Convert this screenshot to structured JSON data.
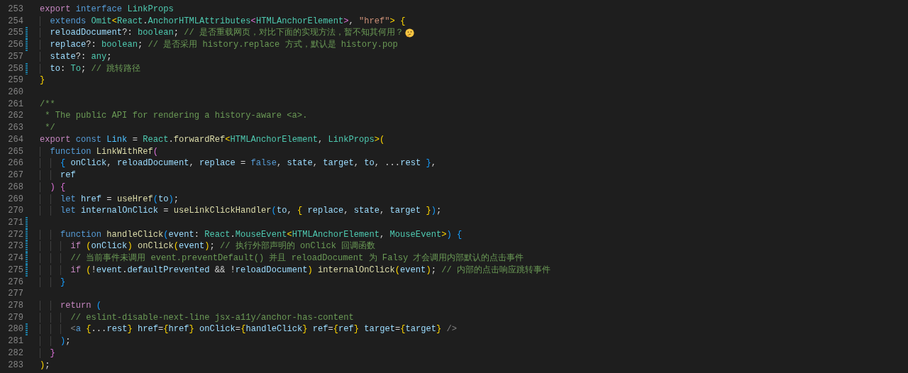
{
  "lines": [
    {
      "number": "253",
      "modified": false,
      "tokens": [
        {
          "kind": "control",
          "text": "export"
        },
        {
          "kind": "keyword",
          "text": " interface"
        },
        {
          "kind": "type",
          "text": " LinkProps"
        }
      ]
    },
    {
      "number": "254",
      "modified": false,
      "tokens": [
        {
          "kind": "keyword",
          "text": "  extends"
        },
        {
          "kind": "type",
          "text": " Omit"
        },
        {
          "kind": "bracket1",
          "text": "<"
        },
        {
          "kind": "type",
          "text": "React"
        },
        {
          "kind": "plain",
          "text": "."
        },
        {
          "kind": "type",
          "text": "AnchorHTMLAttributes"
        },
        {
          "kind": "bracket2",
          "text": "<"
        },
        {
          "kind": "type",
          "text": "HTMLAnchorElement"
        },
        {
          "kind": "bracket2",
          "text": ">"
        },
        {
          "kind": "plain",
          "text": ","
        },
        {
          "kind": "string",
          "text": " \"href\""
        },
        {
          "kind": "bracket1",
          "text": ">"
        },
        {
          "kind": "bracket1",
          "text": " {"
        }
      ]
    },
    {
      "number": "255",
      "modified": true,
      "tokens": [
        {
          "kind": "variable",
          "text": "  reloadDocument"
        },
        {
          "kind": "plain",
          "text": "?:"
        },
        {
          "kind": "type",
          "text": " boolean"
        },
        {
          "kind": "plain",
          "text": ";"
        },
        {
          "kind": "comment",
          "text": " // 是否重载网页，对比下面的实现方法，暂不知其何用？"
        },
        {
          "kind": "emoji"
        }
      ]
    },
    {
      "number": "256",
      "modified": true,
      "tokens": [
        {
          "kind": "variable",
          "text": "  replace"
        },
        {
          "kind": "plain",
          "text": "?:"
        },
        {
          "kind": "type",
          "text": " boolean"
        },
        {
          "kind": "plain",
          "text": ";"
        },
        {
          "kind": "comment",
          "text": " // 是否采用 history.replace 方式，默认是 history.pop"
        }
      ]
    },
    {
      "number": "257",
      "modified": false,
      "tokens": [
        {
          "kind": "variable",
          "text": "  state"
        },
        {
          "kind": "plain",
          "text": "?:"
        },
        {
          "kind": "type",
          "text": " any"
        },
        {
          "kind": "plain",
          "text": ";"
        }
      ]
    },
    {
      "number": "258",
      "modified": true,
      "tokens": [
        {
          "kind": "variable",
          "text": "  to"
        },
        {
          "kind": "plain",
          "text": ":"
        },
        {
          "kind": "type",
          "text": " To"
        },
        {
          "kind": "plain",
          "text": ";"
        },
        {
          "kind": "comment",
          "text": " // 跳转路径"
        }
      ]
    },
    {
      "number": "259",
      "modified": false,
      "tokens": [
        {
          "kind": "bracket1",
          "text": "}"
        }
      ]
    },
    {
      "number": "260",
      "modified": false
    },
    {
      "number": "261",
      "modified": false,
      "tokens": [
        {
          "kind": "comment",
          "text": "/**"
        }
      ]
    },
    {
      "number": "262",
      "modified": false,
      "tokens": [
        {
          "kind": "comment",
          "text": " * The public API for rendering a history-aware <a>."
        }
      ]
    },
    {
      "number": "263",
      "modified": false,
      "tokens": [
        {
          "kind": "comment",
          "text": " */"
        }
      ]
    },
    {
      "number": "264",
      "modified": false,
      "tokens": [
        {
          "kind": "control",
          "text": "export"
        },
        {
          "kind": "keyword",
          "text": " const"
        },
        {
          "kind": "constant",
          "text": " Link"
        },
        {
          "kind": "plain",
          "text": " ="
        },
        {
          "kind": "type",
          "text": " React"
        },
        {
          "kind": "plain",
          "text": "."
        },
        {
          "kind": "function",
          "text": "forwardRef"
        },
        {
          "kind": "bracket1",
          "text": "<"
        },
        {
          "kind": "type",
          "text": "HTMLAnchorElement"
        },
        {
          "kind": "plain",
          "text": ","
        },
        {
          "kind": "type",
          "text": " LinkProps"
        },
        {
          "kind": "bracket1",
          "text": ">"
        },
        {
          "kind": "bracket1",
          "text": "("
        }
      ]
    },
    {
      "number": "265",
      "modified": false,
      "tokens": [
        {
          "kind": "keyword",
          "text": "  function"
        },
        {
          "kind": "function",
          "text": " LinkWithRef"
        },
        {
          "kind": "bracket2",
          "text": "("
        }
      ]
    },
    {
      "number": "266",
      "modified": false,
      "tokens": [
        {
          "kind": "bracket3",
          "text": "    {"
        },
        {
          "kind": "variable",
          "text": " onClick"
        },
        {
          "kind": "plain",
          "text": ","
        },
        {
          "kind": "variable",
          "text": " reloadDocument"
        },
        {
          "kind": "plain",
          "text": ","
        },
        {
          "kind": "variable",
          "text": " replace"
        },
        {
          "kind": "plain",
          "text": " ="
        },
        {
          "kind": "keyword",
          "text": " false"
        },
        {
          "kind": "plain",
          "text": ","
        },
        {
          "kind": "variable",
          "text": " state"
        },
        {
          "kind": "plain",
          "text": ","
        },
        {
          "kind": "variable",
          "text": " target"
        },
        {
          "kind": "plain",
          "text": ","
        },
        {
          "kind": "variable",
          "text": " to"
        },
        {
          "kind": "plain",
          "text": ", ..."
        },
        {
          "kind": "variable",
          "text": "rest"
        },
        {
          "kind": "bracket3",
          "text": " }"
        },
        {
          "kind": "plain",
          "text": ","
        }
      ]
    },
    {
      "number": "267",
      "modified": false,
      "tokens": [
        {
          "kind": "variable",
          "text": "    ref"
        }
      ]
    },
    {
      "number": "268",
      "modified": false,
      "tokens": [
        {
          "kind": "bracket2",
          "text": "  )"
        },
        {
          "kind": "bracket2",
          "text": " {"
        }
      ]
    },
    {
      "number": "269",
      "modified": false,
      "tokens": [
        {
          "kind": "keyword",
          "text": "    let"
        },
        {
          "kind": "variable",
          "text": " href"
        },
        {
          "kind": "plain",
          "text": " ="
        },
        {
          "kind": "function",
          "text": " useHref"
        },
        {
          "kind": "bracket3",
          "text": "("
        },
        {
          "kind": "variable",
          "text": "to"
        },
        {
          "kind": "bracket3",
          "text": ")"
        },
        {
          "kind": "plain",
          "text": ";"
        }
      ]
    },
    {
      "number": "270",
      "modified": false,
      "tokens": [
        {
          "kind": "keyword",
          "text": "    let"
        },
        {
          "kind": "variable",
          "text": " internalOnClick"
        },
        {
          "kind": "plain",
          "text": " ="
        },
        {
          "kind": "function",
          "text": " useLinkClickHandler"
        },
        {
          "kind": "bracket3",
          "text": "("
        },
        {
          "kind": "variable",
          "text": "to"
        },
        {
          "kind": "plain",
          "text": ","
        },
        {
          "kind": "bracket1",
          "text": " {"
        },
        {
          "kind": "variable",
          "text": " replace"
        },
        {
          "kind": "plain",
          "text": ","
        },
        {
          "kind": "variable",
          "text": " state"
        },
        {
          "kind": "plain",
          "text": ","
        },
        {
          "kind": "variable",
          "text": " target"
        },
        {
          "kind": "bracket1",
          "text": " }"
        },
        {
          "kind": "bracket3",
          "text": ")"
        },
        {
          "kind": "plain",
          "text": ";"
        }
      ]
    },
    {
      "number": "271",
      "modified": true
    },
    {
      "number": "272",
      "modified": true,
      "tokens": [
        {
          "kind": "keyword",
          "text": "    function"
        },
        {
          "kind": "function",
          "text": " handleClick"
        },
        {
          "kind": "bracket3",
          "text": "("
        },
        {
          "kind": "variable",
          "text": "event"
        },
        {
          "kind": "plain",
          "text": ":"
        },
        {
          "kind": "type",
          "text": " React"
        },
        {
          "kind": "plain",
          "text": "."
        },
        {
          "kind": "type",
          "text": "MouseEvent"
        },
        {
          "kind": "bracket1",
          "text": "<"
        },
        {
          "kind": "type",
          "text": "HTMLAnchorElement"
        },
        {
          "kind": "plain",
          "text": ","
        },
        {
          "kind": "type",
          "text": " MouseEvent"
        },
        {
          "kind": "bracket1",
          "text": ">"
        },
        {
          "kind": "bracket3",
          "text": ")"
        },
        {
          "kind": "bracket3",
          "text": " {"
        }
      ]
    },
    {
      "number": "273",
      "modified": true,
      "tokens": [
        {
          "kind": "control",
          "text": "      if"
        },
        {
          "kind": "bracket1",
          "text": " ("
        },
        {
          "kind": "variable",
          "text": "onClick"
        },
        {
          "kind": "bracket1",
          "text": ")"
        },
        {
          "kind": "function",
          "text": " onClick"
        },
        {
          "kind": "bracket1",
          "text": "("
        },
        {
          "kind": "variable",
          "text": "event"
        },
        {
          "kind": "bracket1",
          "text": ")"
        },
        {
          "kind": "plain",
          "text": ";"
        },
        {
          "kind": "comment",
          "text": " // 执行外部声明的 onClick 回调函数"
        }
      ]
    },
    {
      "number": "274",
      "modified": true,
      "tokens": [
        {
          "kind": "comment",
          "text": "      // 当前事件未调用 event.preventDefault() 并且 reloadDocument 为 Falsy 才会调用内部默认的点击事件"
        }
      ]
    },
    {
      "number": "275",
      "modified": true,
      "tokens": [
        {
          "kind": "control",
          "text": "      if"
        },
        {
          "kind": "bracket1",
          "text": " ("
        },
        {
          "kind": "plain",
          "text": "!"
        },
        {
          "kind": "variable",
          "text": "event"
        },
        {
          "kind": "plain",
          "text": "."
        },
        {
          "kind": "variable",
          "text": "defaultPrevented"
        },
        {
          "kind": "plain",
          "text": " && !"
        },
        {
          "kind": "variable",
          "text": "reloadDocument"
        },
        {
          "kind": "bracket1",
          "text": ")"
        },
        {
          "kind": "function",
          "text": " internalOnClick"
        },
        {
          "kind": "bracket1",
          "text": "("
        },
        {
          "kind": "variable",
          "text": "event"
        },
        {
          "kind": "bracket1",
          "text": ")"
        },
        {
          "kind": "plain",
          "text": ";"
        },
        {
          "kind": "comment",
          "text": " // 内部的点击响应跳转事件"
        }
      ]
    },
    {
      "number": "276",
      "modified": false,
      "tokens": [
        {
          "kind": "bracket3",
          "text": "    }"
        }
      ]
    },
    {
      "number": "277",
      "modified": false
    },
    {
      "number": "278",
      "modified": false,
      "tokens": [
        {
          "kind": "control",
          "text": "    return"
        },
        {
          "kind": "bracket3",
          "text": " ("
        }
      ]
    },
    {
      "number": "279",
      "modified": false,
      "tokens": [
        {
          "kind": "comment",
          "text": "      // eslint-disable-next-line jsx-a11y/anchor-has-content"
        }
      ]
    },
    {
      "number": "280",
      "modified": true,
      "tokens": [
        {
          "kind": "tag-bracket",
          "text": "      <"
        },
        {
          "kind": "tag",
          "text": "a"
        },
        {
          "kind": "bracket1",
          "text": " {"
        },
        {
          "kind": "plain",
          "text": "..."
        },
        {
          "kind": "variable",
          "text": "rest"
        },
        {
          "kind": "bracket1",
          "text": "}"
        },
        {
          "kind": "variable",
          "text": " href"
        },
        {
          "kind": "plain",
          "text": "="
        },
        {
          "kind": "bracket1",
          "text": "{"
        },
        {
          "kind": "variable",
          "text": "href"
        },
        {
          "kind": "bracket1",
          "text": "}"
        },
        {
          "kind": "variable",
          "text": " onClick"
        },
        {
          "kind": "plain",
          "text": "="
        },
        {
          "kind": "bracket1",
          "text": "{"
        },
        {
          "kind": "variable",
          "text": "handleClick"
        },
        {
          "kind": "bracket1",
          "text": "}"
        },
        {
          "kind": "variable",
          "text": " ref"
        },
        {
          "kind": "plain",
          "text": "="
        },
        {
          "kind": "bracket1",
          "text": "{"
        },
        {
          "kind": "variable",
          "text": "ref"
        },
        {
          "kind": "bracket1",
          "text": "}"
        },
        {
          "kind": "variable",
          "text": " target"
        },
        {
          "kind": "plain",
          "text": "="
        },
        {
          "kind": "bracket1",
          "text": "{"
        },
        {
          "kind": "variable",
          "text": "target"
        },
        {
          "kind": "bracket1",
          "text": "}"
        },
        {
          "kind": "tag-bracket",
          "text": " />"
        }
      ]
    },
    {
      "number": "281",
      "modified": false,
      "tokens": [
        {
          "kind": "bracket3",
          "text": "    )"
        },
        {
          "kind": "plain",
          "text": ";"
        }
      ]
    },
    {
      "number": "282",
      "modified": false,
      "tokens": [
        {
          "kind": "bracket2",
          "text": "  }"
        }
      ]
    },
    {
      "number": "283",
      "modified": false,
      "tokens": [
        {
          "kind": "bracket1",
          "text": ")"
        },
        {
          "kind": "plain",
          "text": ";"
        }
      ]
    }
  ]
}
